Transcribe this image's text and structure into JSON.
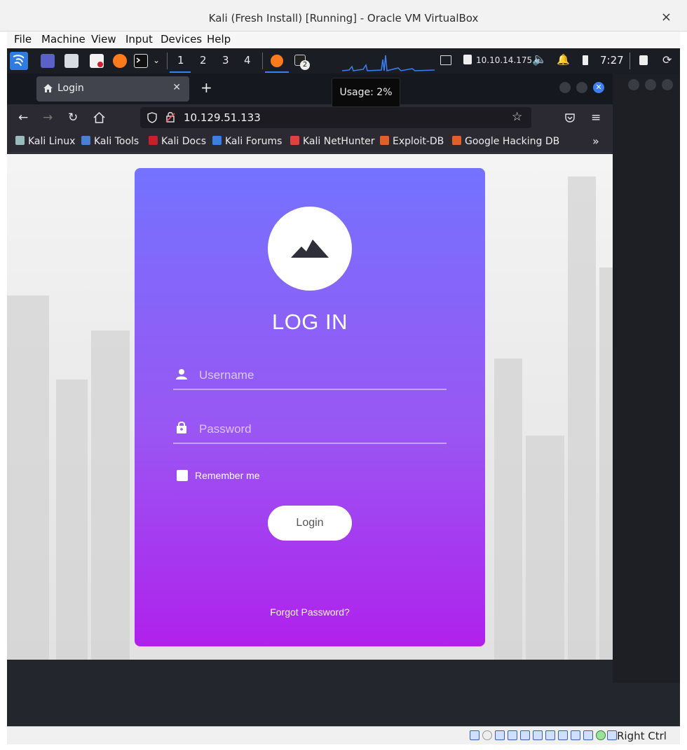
{
  "window": {
    "title": "Kali (Fresh Install) [Running] - Oracle VM VirtualBox",
    "close": "×"
  },
  "menu": [
    "File",
    "Machine",
    "View",
    "Input",
    "Devices",
    "Help"
  ],
  "panel": {
    "workspaces": [
      "1",
      "2",
      "3",
      "4"
    ],
    "active_workspace": "1",
    "terminal_badge": "2",
    "ip": "10.10.14.175",
    "clock": "7:27",
    "icons": [
      "kali-dragon-icon",
      "desktop-icon",
      "file-manager-icon",
      "text-editor-icon",
      "firefox-icon",
      "terminal-icon",
      "network-icon",
      "lock-ip-icon",
      "volume-icon",
      "bell-icon",
      "battery-icon",
      "lock-icon",
      "power-icon"
    ]
  },
  "tooltip": "Usage: 2%",
  "browser": {
    "tab_label": "Login",
    "url": "10.129.51.133",
    "bookmarks": [
      "Kali Linux",
      "Kali Tools",
      "Kali Docs",
      "Kali Forums",
      "Kali NetHunter",
      "Exploit-DB",
      "Google Hacking DB"
    ],
    "overflow": "»"
  },
  "login": {
    "title": "LOG IN",
    "username_placeholder": "Username",
    "password_placeholder": "Password",
    "remember": "Remember me",
    "button": "Login",
    "forgot": "Forgot Password?"
  },
  "statusbar": {
    "host_key": "Right Ctrl"
  }
}
